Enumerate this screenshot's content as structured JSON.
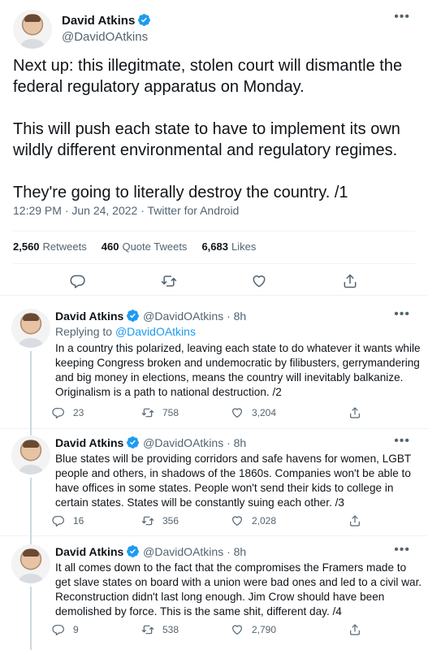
{
  "main_tweet": {
    "author_name": "David Atkins",
    "author_handle": "@DavidOAtkins",
    "text": "Next up: this illegitmate, stolen court will dismantle the federal regulatory apparatus on Monday.\n\nThis will push each state to have to implement its own wildly different environmental and regulatory regimes.\n\nThey're going to literally destroy the country. /1",
    "timestamp": "12:29 PM · Jun 24, 2022 · Twitter for Android",
    "stats": {
      "retweets_count": "2,560",
      "retweets_label": "Retweets",
      "quotes_count": "460",
      "quotes_label": "Quote Tweets",
      "likes_count": "6,683",
      "likes_label": "Likes"
    },
    "more_icon": "more-dots-icon"
  },
  "replies": [
    {
      "author_name": "David Atkins",
      "author_handle": "@DavidOAtkins",
      "time": "· 8h",
      "replying_prefix": "Replying to",
      "replying_to": "@DavidOAtkins",
      "text": "In a country this polarized, leaving each state to do whatever it wants while keeping Congress broken and undemocratic by filibusters, gerrymandering and big money in elections, means the country will inevitably balkanize. Originalism is a path to national destruction. /2",
      "replies": "23",
      "retweets": "758",
      "likes": "3,204"
    },
    {
      "author_name": "David Atkins",
      "author_handle": "@DavidOAtkins",
      "time": "· 8h",
      "text": "Blue states will be providing corridors and safe havens for women, LGBT people and others, in shadows of the 1860s. Companies won't be able to have offices in some states. People won't send their kids to college in certain states. States will be constantly suing each other. /3",
      "replies": "16",
      "retweets": "356",
      "likes": "2,028"
    },
    {
      "author_name": "David Atkins",
      "author_handle": "@DavidOAtkins",
      "time": "· 8h",
      "text": "It all comes down to the fact that the compromises the Framers made to get slave states on board with a union were bad ones and led to a civil war. Reconstruction didn't last long enough. Jim Crow should have been demolished by force. This is the same shit, different day. /4",
      "replies": "9",
      "retweets": "538",
      "likes": "2,790"
    }
  ],
  "colors": {
    "accent": "#1d9bf0",
    "text": "#0f1419",
    "muted": "#536471",
    "divider": "#eff3f4"
  },
  "icons": [
    "verified-badge-icon",
    "reply-icon",
    "retweet-icon",
    "like-icon",
    "share-icon",
    "more-dots-icon"
  ]
}
